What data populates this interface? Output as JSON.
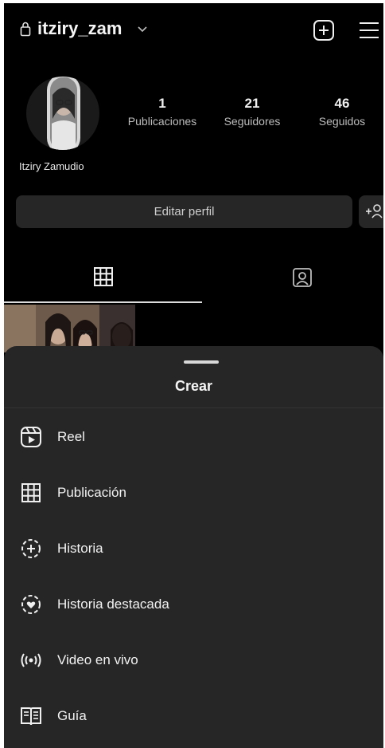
{
  "header": {
    "username": "itziry_zam"
  },
  "profile": {
    "display_name": "Itziry Zamudio",
    "stats": [
      {
        "value": "1",
        "label": "Publicaciones"
      },
      {
        "value": "21",
        "label": "Seguidores"
      },
      {
        "value": "46",
        "label": "Seguidos"
      }
    ],
    "edit_label": "Editar perfil"
  },
  "tabs": {
    "items": [
      {
        "icon": "grid-icon",
        "active": true
      },
      {
        "icon": "tagged-icon",
        "active": false
      }
    ]
  },
  "sheet": {
    "title": "Crear",
    "items": [
      {
        "label": "Reel",
        "icon": "reel-icon"
      },
      {
        "label": "Publicación",
        "icon": "grid-post-icon"
      },
      {
        "label": "Historia",
        "icon": "story-add-icon"
      },
      {
        "label": "Historia destacada",
        "icon": "highlight-icon"
      },
      {
        "label": "Video en vivo",
        "icon": "live-icon"
      },
      {
        "label": "Guía",
        "icon": "guide-icon"
      }
    ]
  },
  "colors": {
    "background": "#000000",
    "sheet": "#262626",
    "text": "#f5f5f5",
    "muted": "#bdbdbd"
  }
}
